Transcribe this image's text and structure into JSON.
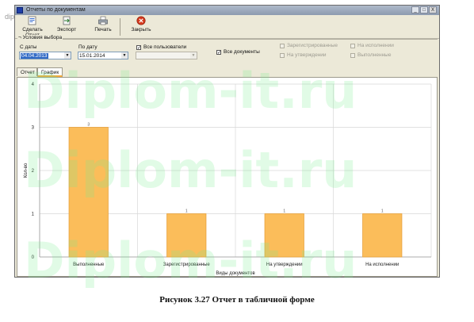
{
  "site_mark": "diplom-it.ru",
  "window": {
    "title": "Отчеты по документам",
    "controls": [
      "_",
      "□",
      "X"
    ]
  },
  "toolbar": {
    "items": [
      {
        "label": "Сделать Отчет",
        "icon": "report-icon"
      },
      {
        "label": "Экспорт",
        "icon": "export-icon"
      },
      {
        "label": "Печать",
        "icon": "printer-icon"
      },
      {
        "label": "Закрыть",
        "icon": "close-icon"
      }
    ]
  },
  "filters": {
    "group_label": "Условия выбора",
    "from_label": "С даты",
    "from_value": "04.04.2013",
    "to_label": "По дату",
    "to_value": "15.01.2014",
    "all_users_label": "Все пользователи",
    "all_users_checked": true,
    "user_value": "",
    "all_docs_label": "Все документы",
    "all_docs_checked": true,
    "statuses": [
      {
        "label": "Зарегистрированные",
        "checked": false
      },
      {
        "label": "На исполнении",
        "checked": false
      },
      {
        "label": "На утверждении",
        "checked": false
      },
      {
        "label": "Выполненные",
        "checked": false
      }
    ]
  },
  "tabs": [
    {
      "label": "Отчет",
      "active": false
    },
    {
      "label": "График",
      "active": true
    }
  ],
  "chart_data": {
    "type": "bar",
    "categories": [
      "Выполненные",
      "Зарегистрированные",
      "На утверждении",
      "На исполнении"
    ],
    "values": [
      3,
      1,
      1,
      1
    ],
    "data_labels": [
      "3",
      "1",
      "1",
      "1"
    ],
    "xlabel": "Виды документов",
    "ylabel": "Кол-во",
    "ylim": [
      0,
      4
    ],
    "yticks": [
      "0",
      "1",
      "2",
      "3",
      "4"
    ],
    "grid": true,
    "bar_color": "#fbbd5a",
    "bar_edge_color": "#e8a23e"
  },
  "caption": "Рисунок 3.27 Отчет в табличной форме",
  "watermark": "Diplom-it.ru"
}
